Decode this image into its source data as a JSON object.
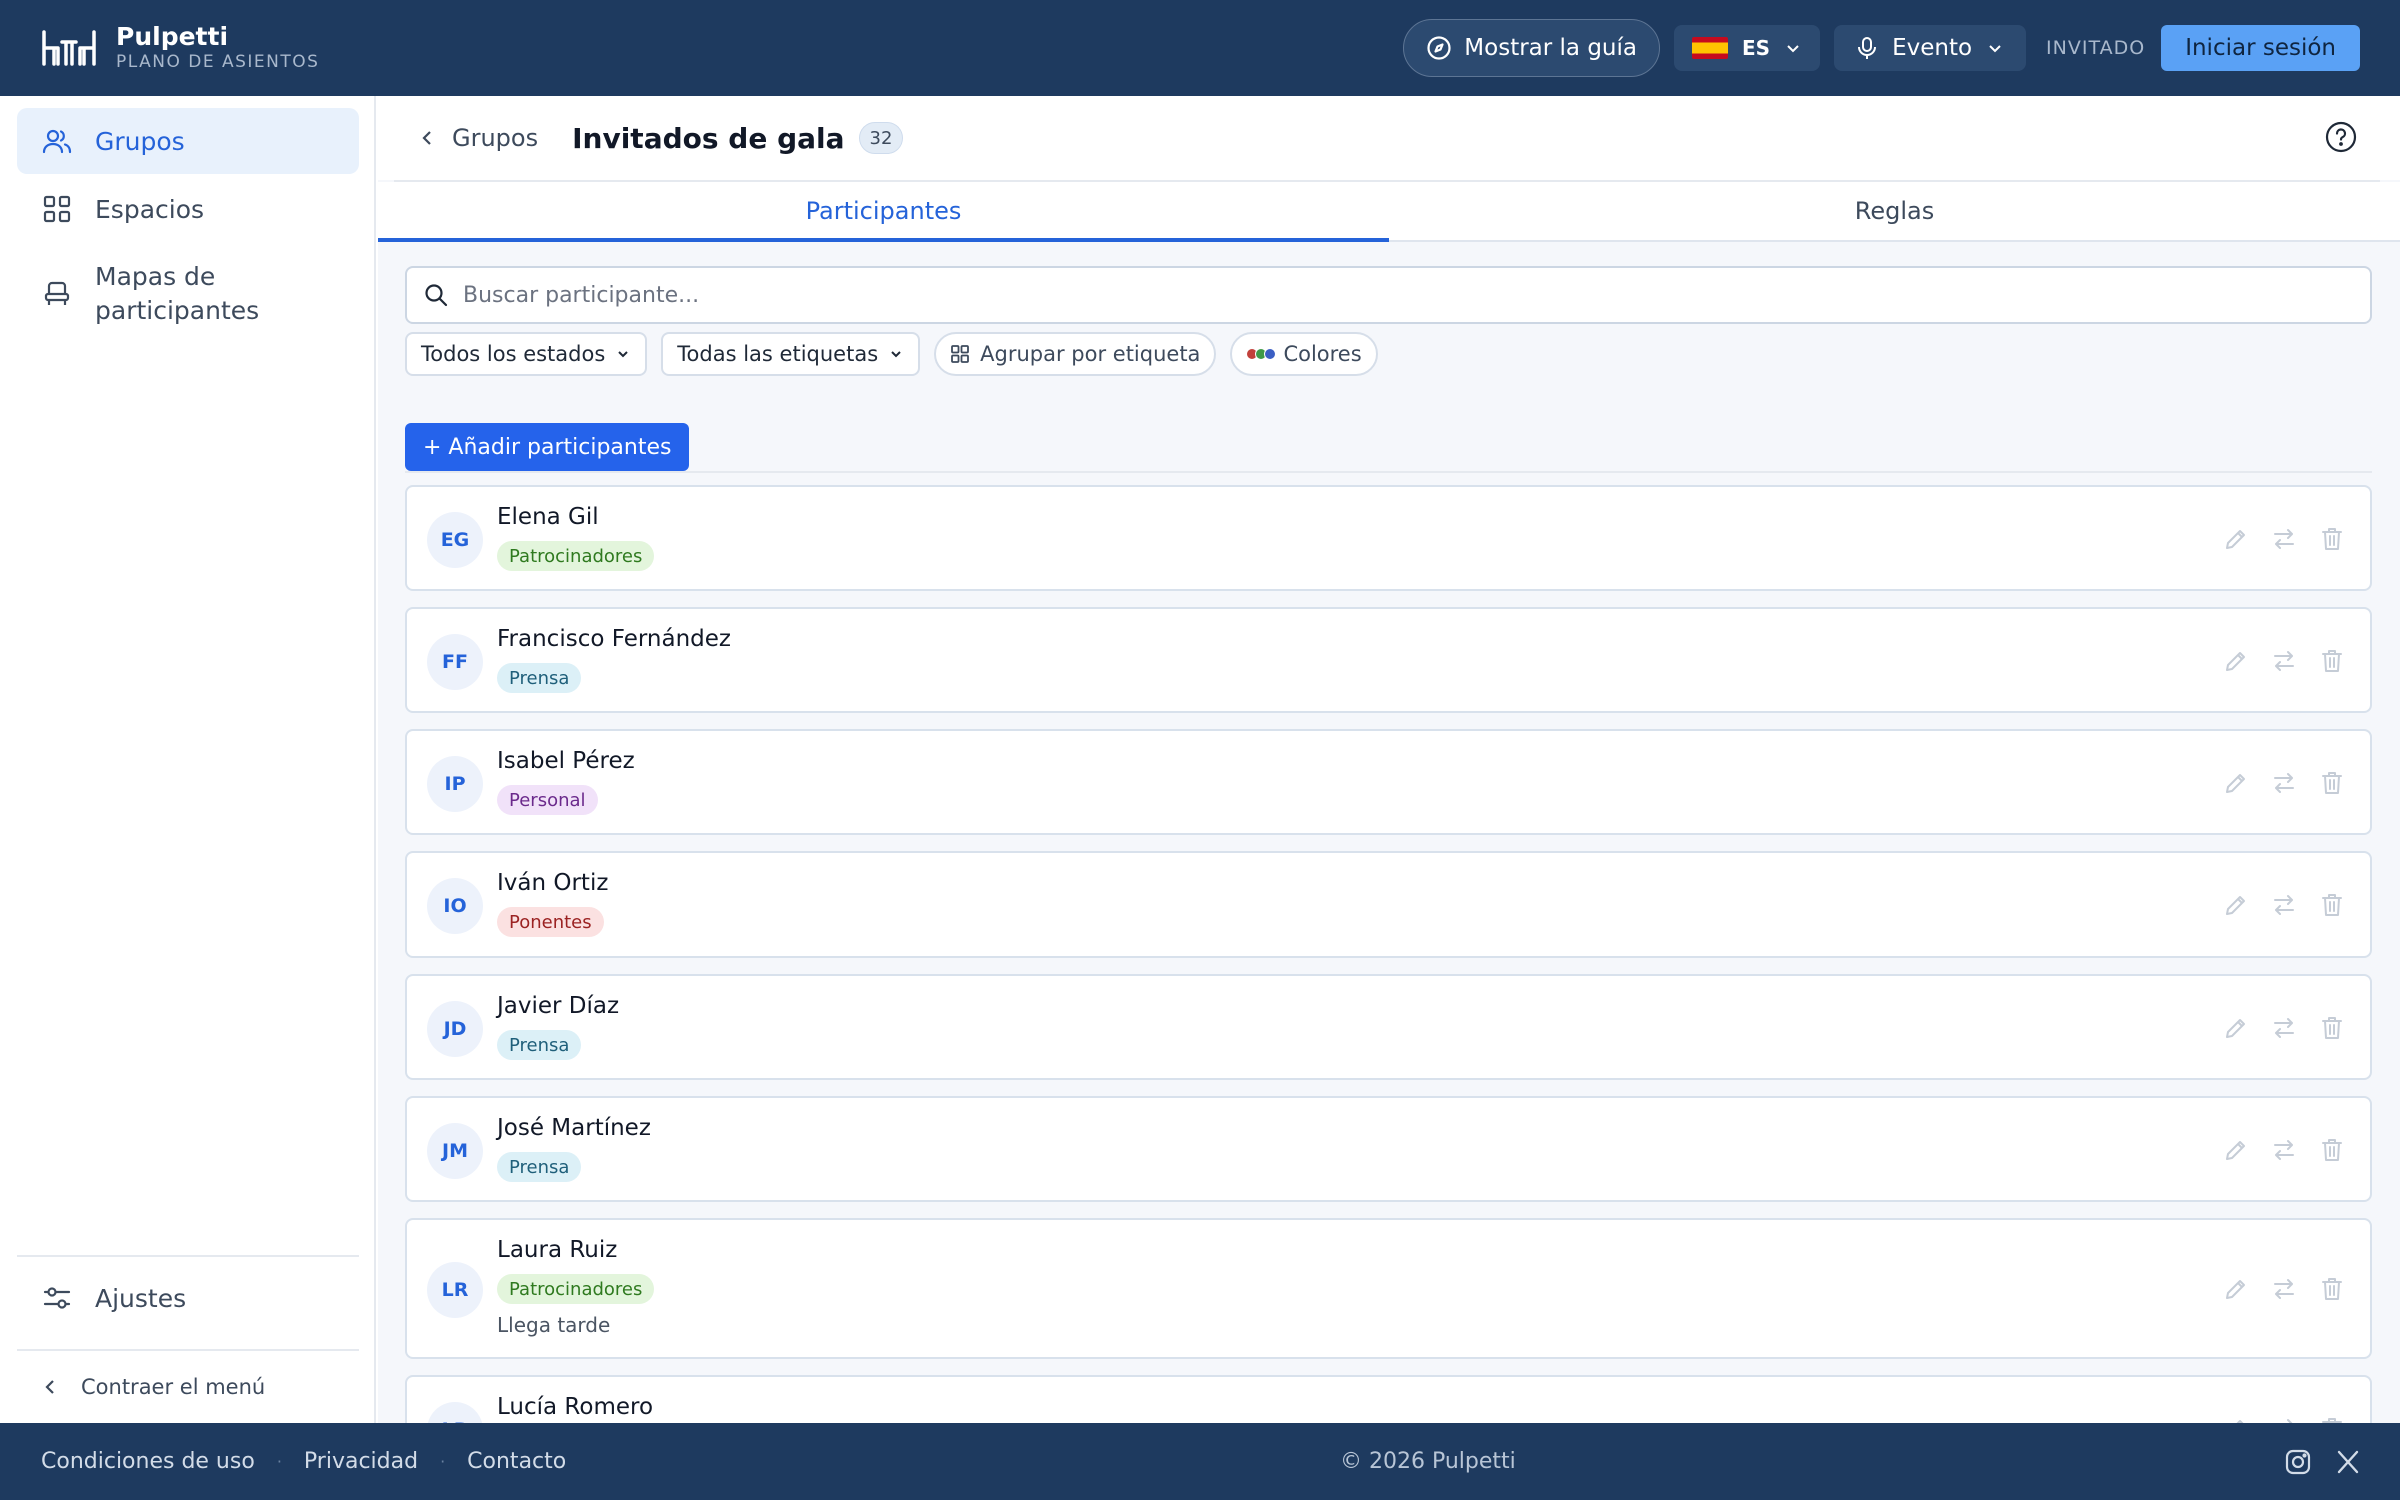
{
  "header": {
    "brand_title": "Pulpetti",
    "brand_subtitle": "PLANO DE ASIENTOS",
    "guide_label": "Mostrar la guía",
    "language": "ES",
    "event_label": "Evento",
    "role_label": "INVITADO",
    "login_label": "Iniciar sesión"
  },
  "sidebar": {
    "items": [
      {
        "label": "Grupos",
        "icon": "users-icon",
        "active": true
      },
      {
        "label": "Espacios",
        "icon": "grid-icon",
        "active": false
      },
      {
        "label": "Mapas de participantes",
        "icon": "seat-icon",
        "active": false
      }
    ],
    "settings_label": "Ajustes",
    "collapse_label": "Contraer el menú"
  },
  "breadcrumb": {
    "back_label": "Grupos",
    "title": "Invitados de gala",
    "count": "32"
  },
  "tabs": [
    {
      "label": "Participantes",
      "active": true
    },
    {
      "label": "Reglas",
      "active": false
    }
  ],
  "search": {
    "placeholder": "Buscar participante...",
    "value": ""
  },
  "filters": {
    "status_label": "Todos los estados",
    "tags_label": "Todas las etiquetas",
    "group_label": "Agrupar por etiqueta",
    "colors_label": "Colores"
  },
  "add_button_label": "+ Añadir participantes",
  "participants": [
    {
      "initials": "EG",
      "name": "Elena Gil",
      "tag": "Patrocinadores",
      "tag_color": "#2f7a1f",
      "tag_bg": "#e3f5dc",
      "note": ""
    },
    {
      "initials": "FF",
      "name": "Francisco Fernández",
      "tag": "Prensa",
      "tag_color": "#1f5f7a",
      "tag_bg": "#dcf0f7",
      "note": ""
    },
    {
      "initials": "IP",
      "name": "Isabel Pérez",
      "tag": "Personal",
      "tag_color": "#6b2a8c",
      "tag_bg": "#f1e2f9",
      "note": ""
    },
    {
      "initials": "IO",
      "name": "Iván Ortiz",
      "tag": "Ponentes",
      "tag_color": "#9b2222",
      "tag_bg": "#fbe1e1",
      "note": ""
    },
    {
      "initials": "JD",
      "name": "Javier Díaz",
      "tag": "Prensa",
      "tag_color": "#1f5f7a",
      "tag_bg": "#dcf0f7",
      "note": ""
    },
    {
      "initials": "JM",
      "name": "José Martínez",
      "tag": "Prensa",
      "tag_color": "#1f5f7a",
      "tag_bg": "#dcf0f7",
      "note": ""
    },
    {
      "initials": "LR",
      "name": "Laura Ruiz",
      "tag": "Patrocinadores",
      "tag_color": "#2f7a1f",
      "tag_bg": "#e3f5dc",
      "note": "Llega tarde"
    },
    {
      "initials": "LR",
      "name": "Lucía Romero",
      "tag": "",
      "tag_color": "#2f7a1f",
      "tag_bg": "#e3f5dc",
      "note": ""
    }
  ],
  "footer": {
    "links": [
      "Condiciones de uso",
      "Privacidad",
      "Contacto"
    ],
    "copyright": "© 2026 Pulpetti"
  },
  "colors": {
    "header_bg": "#1e3a5f",
    "accent": "#2563d9",
    "primary_button": "#2563eb",
    "login_button": "#5aa1f5"
  }
}
